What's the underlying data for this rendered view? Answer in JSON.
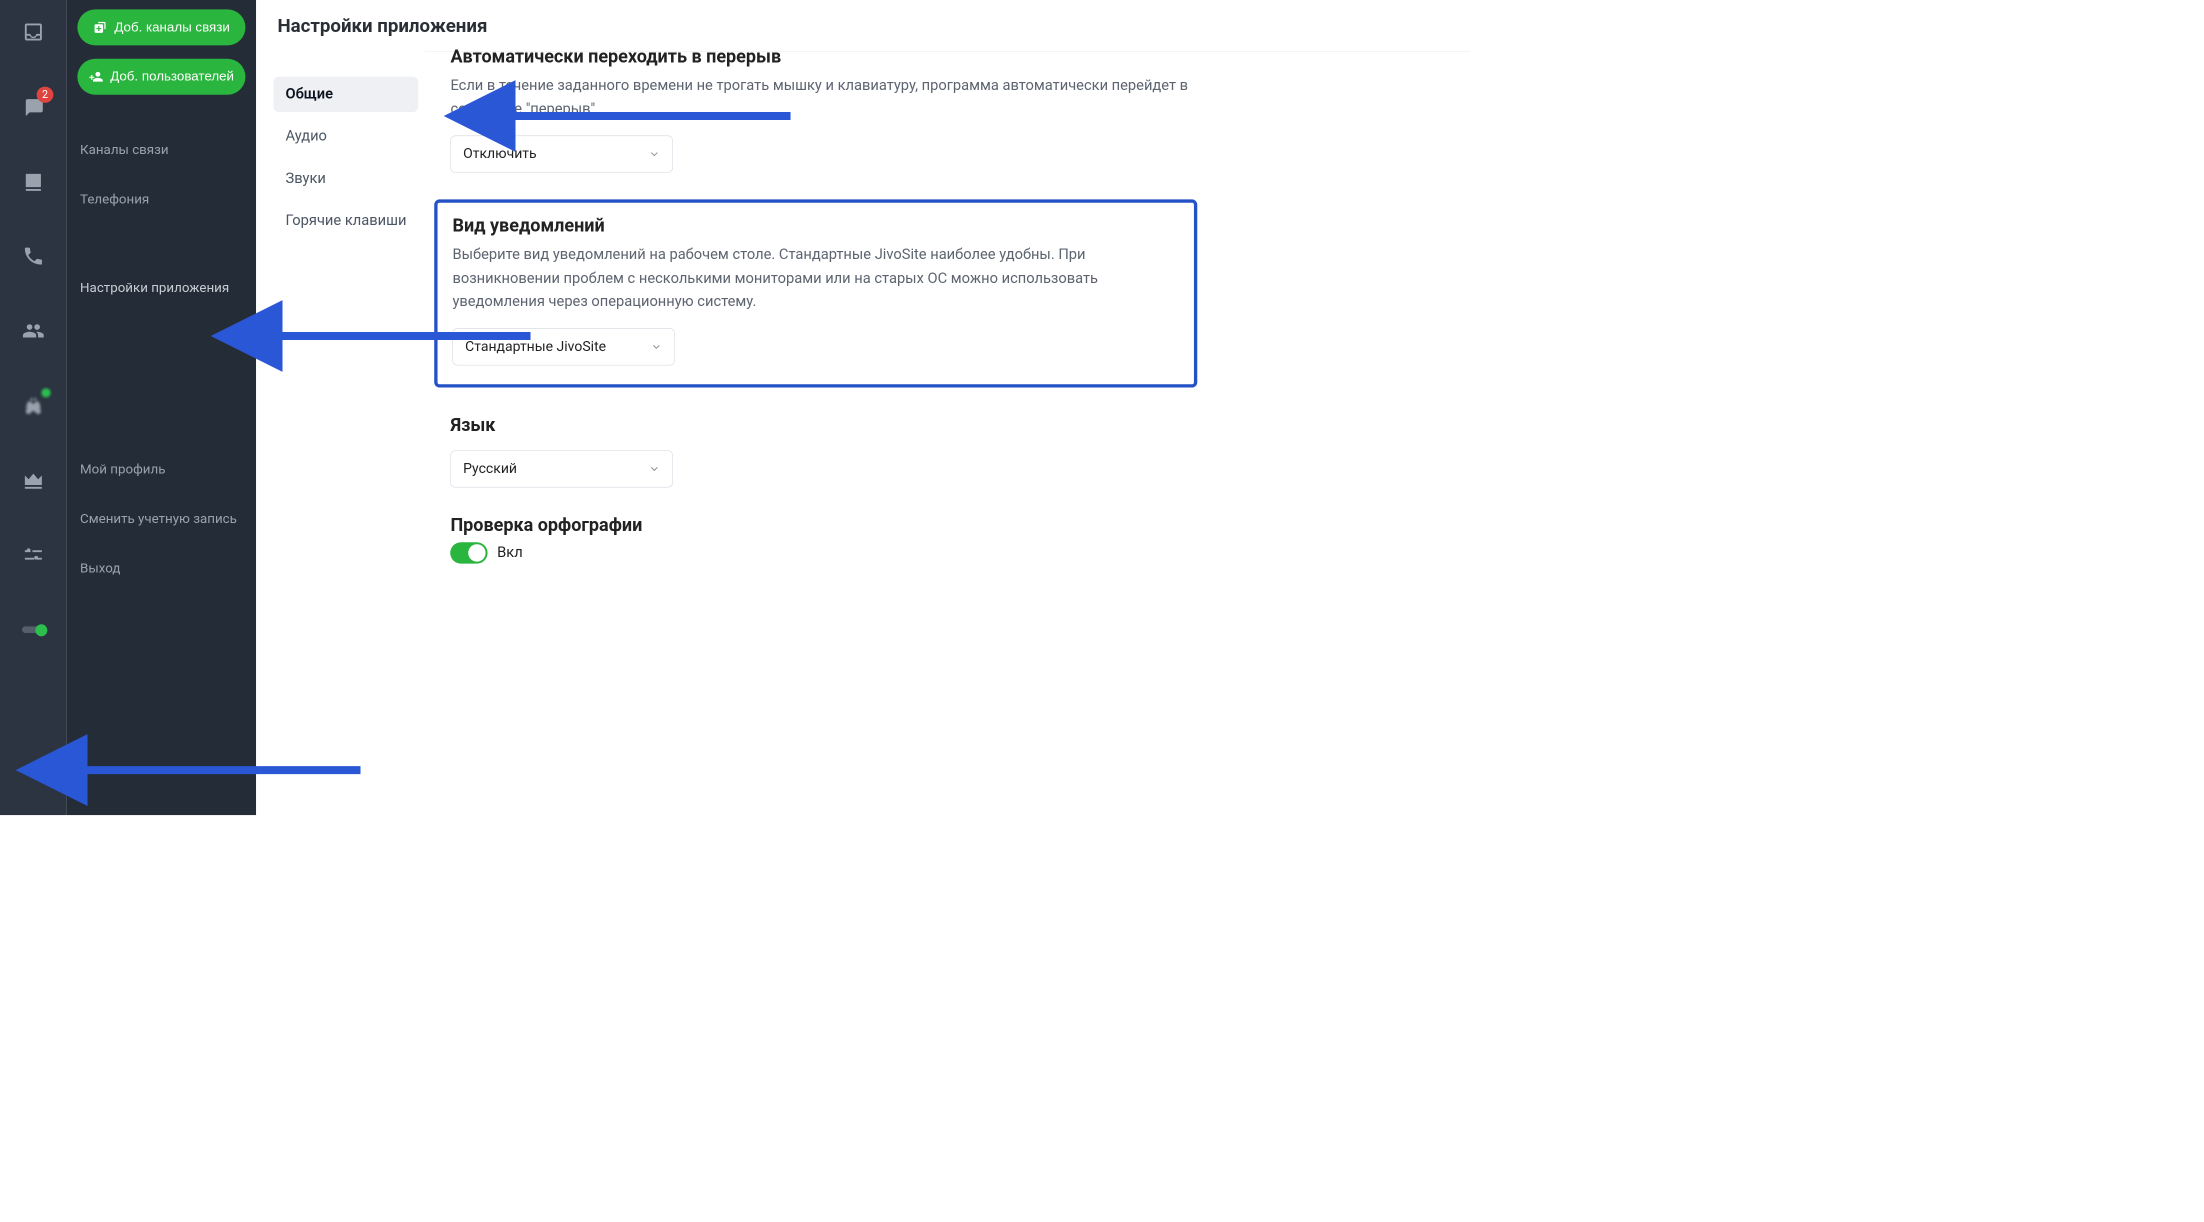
{
  "iconbar": {
    "chat_badge": "2"
  },
  "sidebar": {
    "btn_add_channels": "Доб. каналы связи",
    "btn_add_users": "Доб. пользователей",
    "nav": {
      "channels": "Каналы связи",
      "telephony": "Телефония",
      "app_settings": "Настройки приложения",
      "my_profile": "Мой профиль",
      "switch_account": "Сменить учетную запись",
      "logout": "Выход"
    }
  },
  "page": {
    "title": "Настройки приложения",
    "tabs": {
      "general": "Общие",
      "audio": "Аудио",
      "sounds": "Звуки",
      "hotkeys": "Горячие клавиши"
    },
    "autobreak": {
      "title": "Автоматически переходить в перерыв",
      "desc": "Если в течение заданного времени не трогать мышку и клавиатуру, программа автоматически перейдет в состояние \"перерыв\"",
      "value": "Отключить"
    },
    "notifications": {
      "title": "Вид уведомлений",
      "desc": "Выберите вид уведомлений на рабочем столе. Стандартные JivoSite наиболее удобны. При возникновении проблем с несколькими мониторами или на старых ОС можно использовать уведомления через операционную систему.",
      "value": "Стандартные JivoSite"
    },
    "language": {
      "title": "Язык",
      "value": "Русский"
    },
    "spellcheck": {
      "title": "Проверка орфографии",
      "value": "Вкл"
    }
  }
}
